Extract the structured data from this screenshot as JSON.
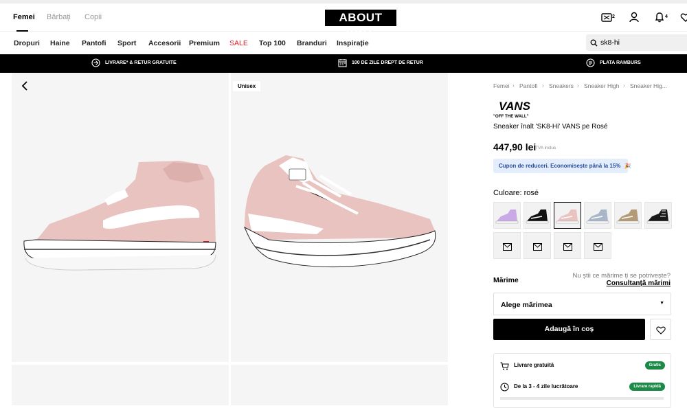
{
  "header": {
    "genders": [
      "Femei",
      "Bărbați",
      "Copii"
    ],
    "logo": "ABOUT YOU",
    "cart_count": "2",
    "notif_count": "4"
  },
  "nav": {
    "items": [
      "Dropuri",
      "Haine",
      "Pantofi",
      "Sport",
      "Accesorii",
      "Premium",
      "SALE",
      "Top 100",
      "Branduri",
      "Inspirație"
    ],
    "search_value": "sk8-hi"
  },
  "promo": {
    "items": [
      "Livrare* & retur gratuite",
      "100 de zile drept de retur",
      "Plata ramburs"
    ]
  },
  "gallery": {
    "badge": "Unisex"
  },
  "product": {
    "breadcrumb": [
      "Femei",
      "Pantofi",
      "Sneakers",
      "Sneaker High",
      "Sneaker Hig..."
    ],
    "brand_logo": "VANS",
    "brand_tagline": "\"OFF THE WALL\"",
    "title": "Sneaker înalt 'SK8-Hi' VANS pe Rosé",
    "price": "447,90 lei",
    "vat": "TVA inclus",
    "coupon": "Cupon de reduceri. Economisește până la 15%",
    "color_label": "Culoare: rosé",
    "size_label": "Mărime",
    "size_help": "Nu știi ce mărime ți se potrivește?",
    "size_link": "Consultanță mărimi",
    "size_placeholder": "Alege mărimea",
    "add_to_cart": "Adaugă în coș",
    "delivery": [
      {
        "text": "Livrare gratuită",
        "badge": "Gratis"
      },
      {
        "text": "De la 3 - 4 zile lucrătoare",
        "badge": "Livrare rapidă"
      }
    ]
  },
  "colors": {
    "pink": "#e8c3c0",
    "lilac": "#c9a9e6",
    "promo_bg": "#000000",
    "sale": "#e01b22",
    "badge_green": "#1a8a46",
    "coupon_bg": "#e3edfb"
  }
}
